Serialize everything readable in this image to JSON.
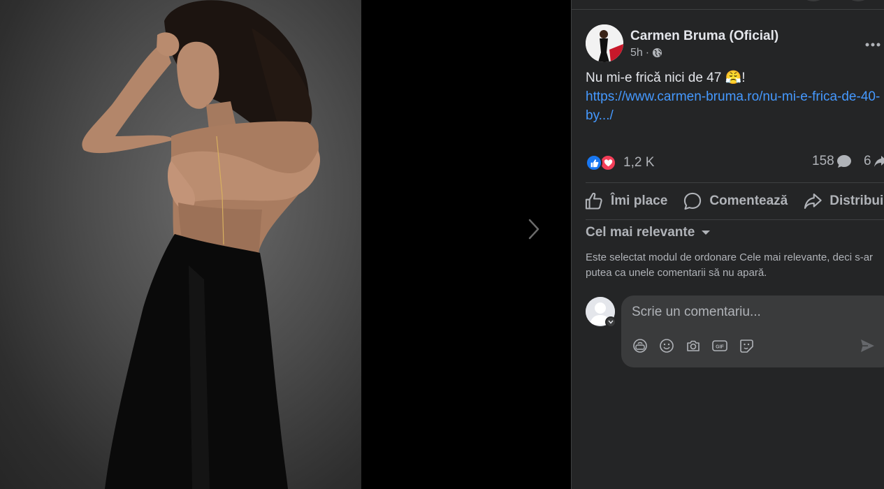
{
  "post": {
    "author": "Carmen Bruma (Oficial)",
    "time": "5h",
    "separator": "·",
    "text": "Nu mi-e frică nici de 47 😤!",
    "link": "https://www.carmen-bruma.ro/nu-mi-e-frica-de-40-by.../"
  },
  "stats": {
    "reactions": "1,2 K",
    "comments": "158",
    "shares": "6"
  },
  "actions": {
    "like": "Îmi place",
    "comment": "Comentează",
    "share": "Distribuie"
  },
  "comments": {
    "sort_label": "Cel mai relevante",
    "sort_note": "Este selectat modul de ordonare Cele mai relevante, deci s-ar putea ca unele comentarii să nu apară.",
    "placeholder": "Scrie un comentariu..."
  },
  "colors": {
    "panel_bg": "#242526",
    "link": "#4599ff",
    "like_blue": "#1877f2",
    "love_red": "#f33e58"
  },
  "icons": [
    "globe-icon",
    "more-icon",
    "like-reaction-icon",
    "love-reaction-icon",
    "comment-bubble-icon",
    "share-arrow-icon",
    "thumbs-up-icon",
    "caret-down-icon",
    "avatar-sticker-icon",
    "emoji-icon",
    "camera-icon",
    "gif-icon",
    "sticker-icon",
    "send-icon",
    "chevron-right-icon"
  ]
}
